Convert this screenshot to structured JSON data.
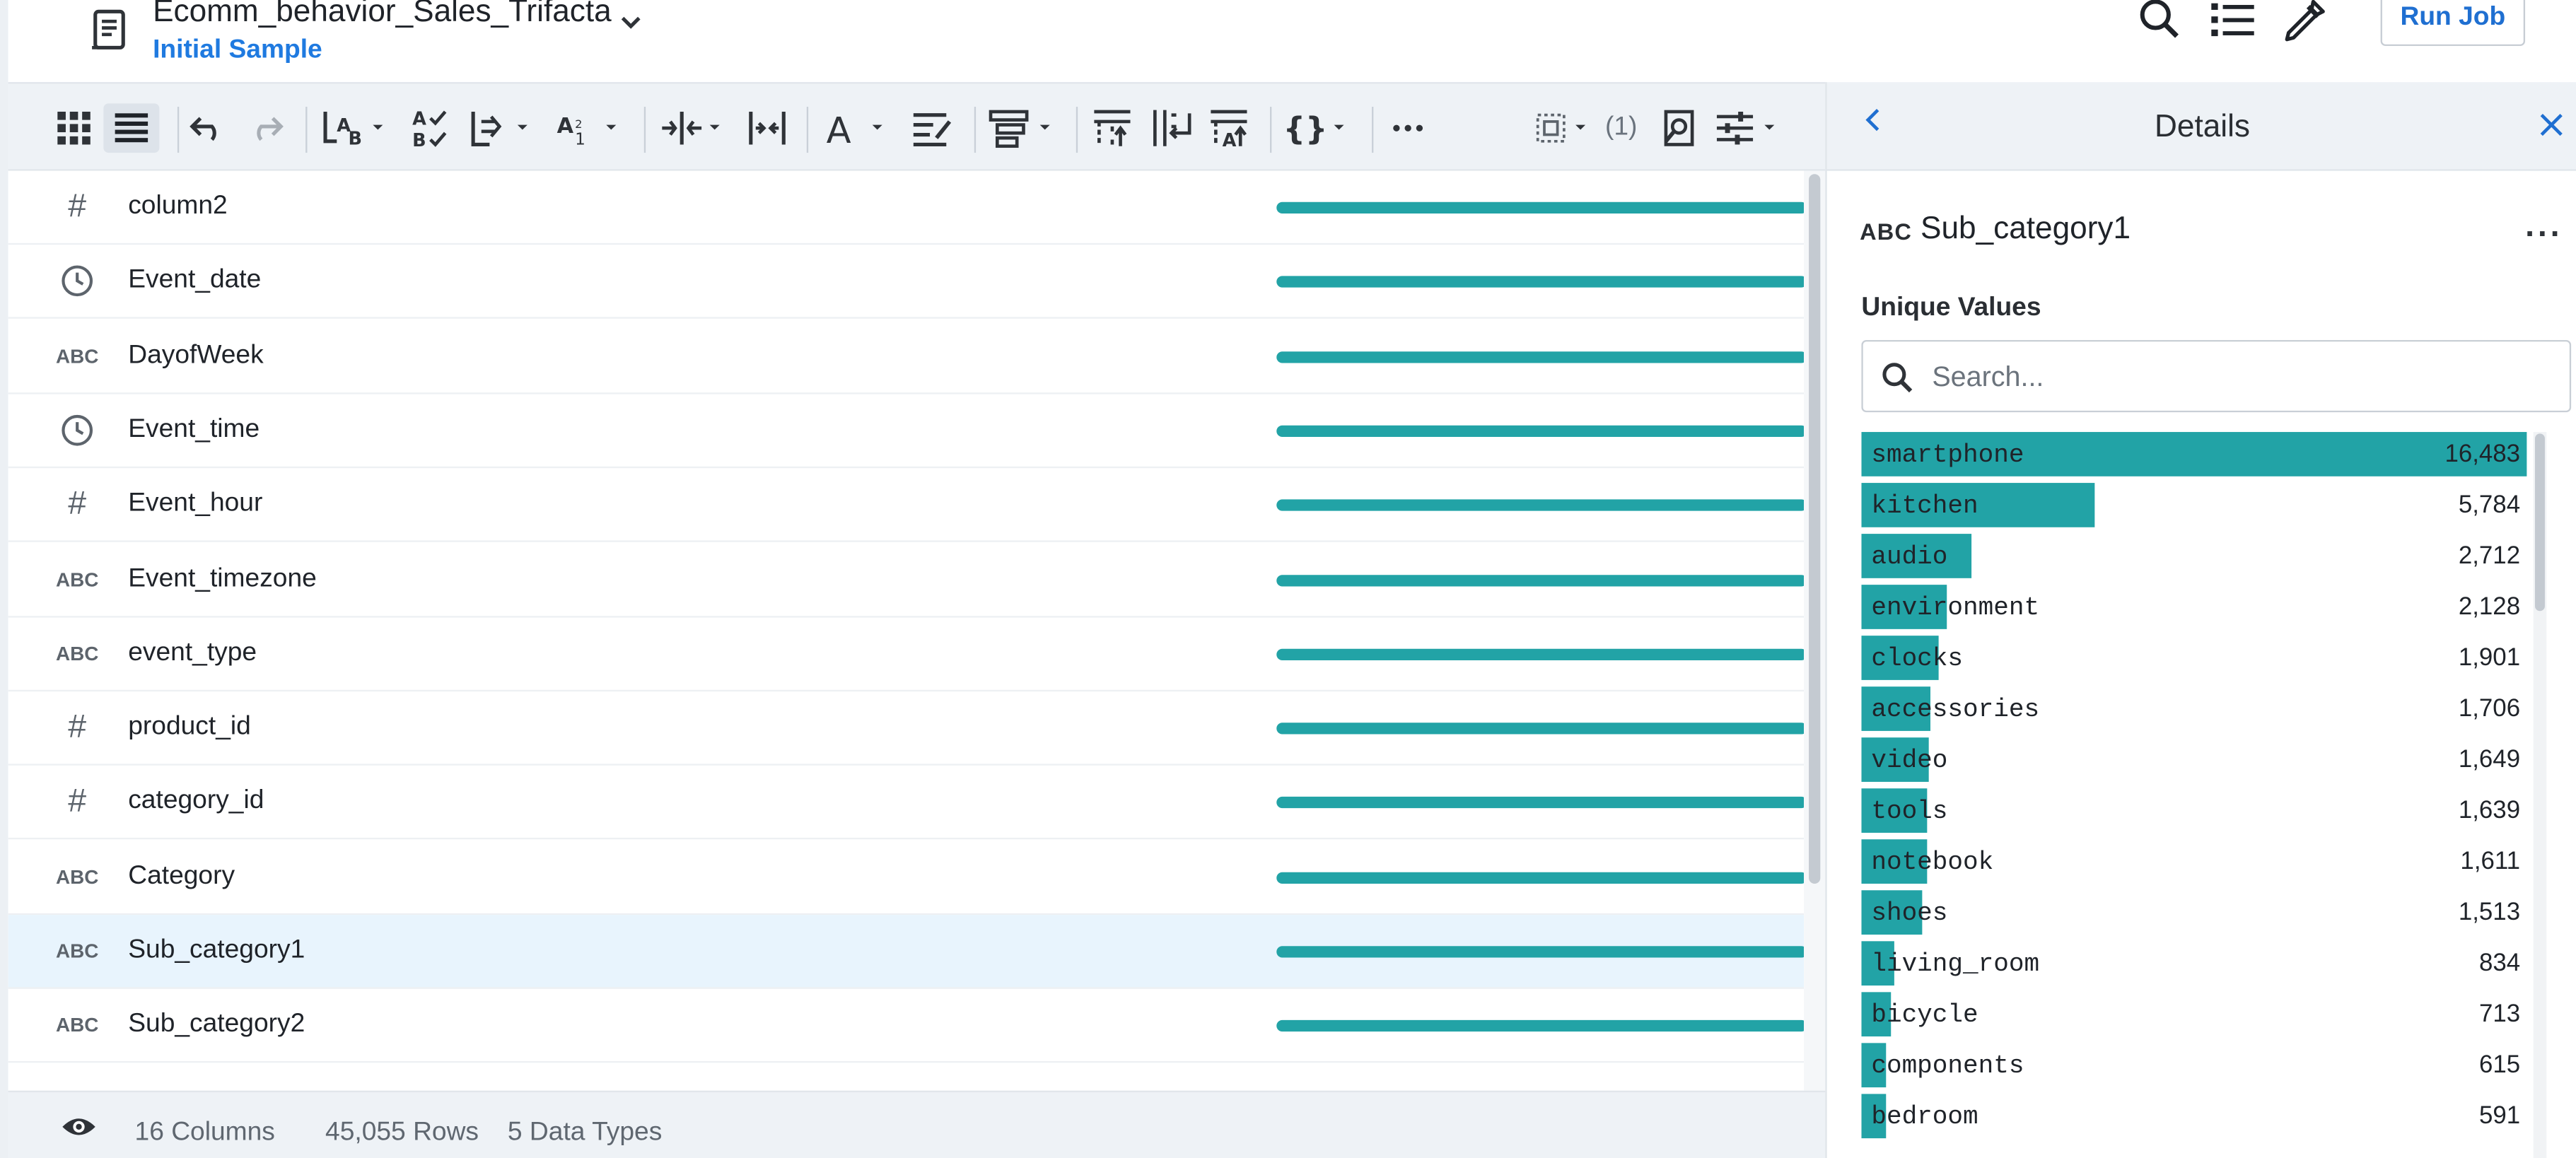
{
  "header": {
    "title": "Ecomm_behavior_Sales_Trifacta",
    "subtitle": "Initial Sample",
    "run_job_label": "Run Job",
    "icons": [
      "search-icon",
      "list-icon",
      "eyedropper-icon"
    ]
  },
  "toolbar": {
    "icons": [
      "grid-view-icon",
      "list-view-icon",
      "undo-icon",
      "redo-icon",
      "replace-icon",
      "filter-icon",
      "split-icon",
      "sort-icon",
      "move-icon",
      "merge-columns-icon",
      "format-text-icon",
      "rename-icon",
      "extract-icon",
      "pivot-icon",
      "unpivot-icon",
      "restructure-icon",
      "nested-icon",
      "more-icon",
      "select-columns-icon",
      "inspect-icon",
      "settings-icon"
    ],
    "selection_count": "(1)",
    "more_label": "···"
  },
  "columns": [
    {
      "type": "integer",
      "name": "column2",
      "selected": false
    },
    {
      "type": "datetime",
      "name": "Event_date",
      "selected": false
    },
    {
      "type": "string",
      "name": "DayofWeek",
      "selected": false
    },
    {
      "type": "datetime",
      "name": "Event_time",
      "selected": false
    },
    {
      "type": "integer",
      "name": "Event_hour",
      "selected": false
    },
    {
      "type": "string",
      "name": "Event_timezone",
      "selected": false
    },
    {
      "type": "string",
      "name": "event_type",
      "selected": false
    },
    {
      "type": "integer",
      "name": "product_id",
      "selected": false
    },
    {
      "type": "integer",
      "name": "category_id",
      "selected": false
    },
    {
      "type": "string",
      "name": "Category",
      "selected": false
    },
    {
      "type": "string",
      "name": "Sub_category1",
      "selected": true
    },
    {
      "type": "string",
      "name": "Sub_category2",
      "selected": false
    }
  ],
  "type_glyphs": {
    "integer": "#",
    "string": "ABC"
  },
  "footer": {
    "columns": "16 Columns",
    "rows": "45,055 Rows",
    "data_types": "5 Data Types"
  },
  "details": {
    "panel_title": "Details",
    "column_type": "ABC",
    "column_name": "Sub_category1",
    "menu": "···",
    "unique_values_label": "Unique Values",
    "search_placeholder": "Search...",
    "values": [
      {
        "label": "smartphone",
        "count": "16,483",
        "n": 16483
      },
      {
        "label": "kitchen",
        "count": "5,784",
        "n": 5784
      },
      {
        "label": "audio",
        "count": "2,712",
        "n": 2712
      },
      {
        "label": "environment",
        "count": "2,128",
        "n": 2128
      },
      {
        "label": "clocks",
        "count": "1,901",
        "n": 1901
      },
      {
        "label": "accessories",
        "count": "1,706",
        "n": 1706
      },
      {
        "label": "video",
        "count": "1,649",
        "n": 1649
      },
      {
        "label": "tools",
        "count": "1,639",
        "n": 1639
      },
      {
        "label": "notebook",
        "count": "1,611",
        "n": 1611
      },
      {
        "label": "shoes",
        "count": "1,513",
        "n": 1513
      },
      {
        "label": "living_room",
        "count": "834",
        "n": 834
      },
      {
        "label": "bicycle",
        "count": "713",
        "n": 713
      },
      {
        "label": "components",
        "count": "615",
        "n": 615
      },
      {
        "label": "bedroom",
        "count": "591",
        "n": 591
      }
    ]
  },
  "colors": {
    "accent": "#22a3a6",
    "link": "#1f7ae0",
    "selected_row": "#e8f4fd",
    "toolbar_bg": "#eef2f6"
  }
}
